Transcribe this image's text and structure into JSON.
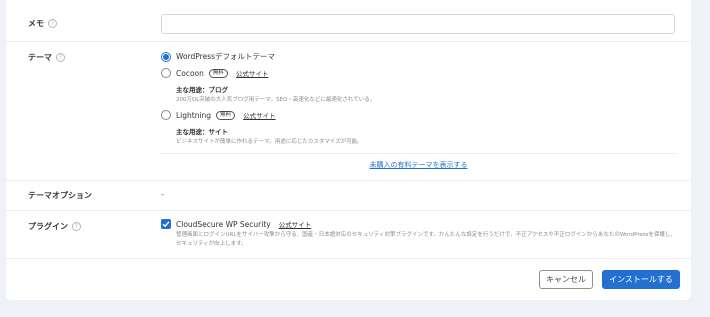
{
  "memo": {
    "label": "メモ",
    "help": "?",
    "value": ""
  },
  "theme": {
    "label": "テーマ",
    "help": "?",
    "options": [
      {
        "name": "WordPressデフォルトテーマ",
        "selected": true
      },
      {
        "name": "Cocoon",
        "badge": "無料",
        "link": "公式サイト",
        "usage": "主な用途：ブログ",
        "desc": "200万DL突破の大人気ブログ用テーマ。SEO・高速化などに最適化されている。",
        "selected": false
      },
      {
        "name": "Lightning",
        "badge": "無料",
        "link": "公式サイト",
        "usage": "主な用途：サイト",
        "desc": "ビジネスサイトが簡単に作れるテーマ。用途に応じたカスタマイズが可能。",
        "selected": false
      }
    ],
    "show_paid": "未購入の有料テーマを表示する"
  },
  "theme_option": {
    "label": "テーマオプション",
    "value": "-"
  },
  "plugin": {
    "label": "プラグイン",
    "help": "?",
    "name": "CloudSecure WP Security",
    "link": "公式サイト",
    "checked": true,
    "desc": "管理画面とログインURLをサイバー攻撃から守る、国産・日本語対応のセキュリティ対策プラグインです。かんたんな設定を行うだけで、不正アクセスや不正ログインからあなたのWordPressを保護し、セキュリティが向上します。"
  },
  "buttons": {
    "cancel": "キャンセル",
    "install": "インストールする"
  },
  "colors": {
    "accent": "#2271d1",
    "background": "#eef1f6"
  }
}
